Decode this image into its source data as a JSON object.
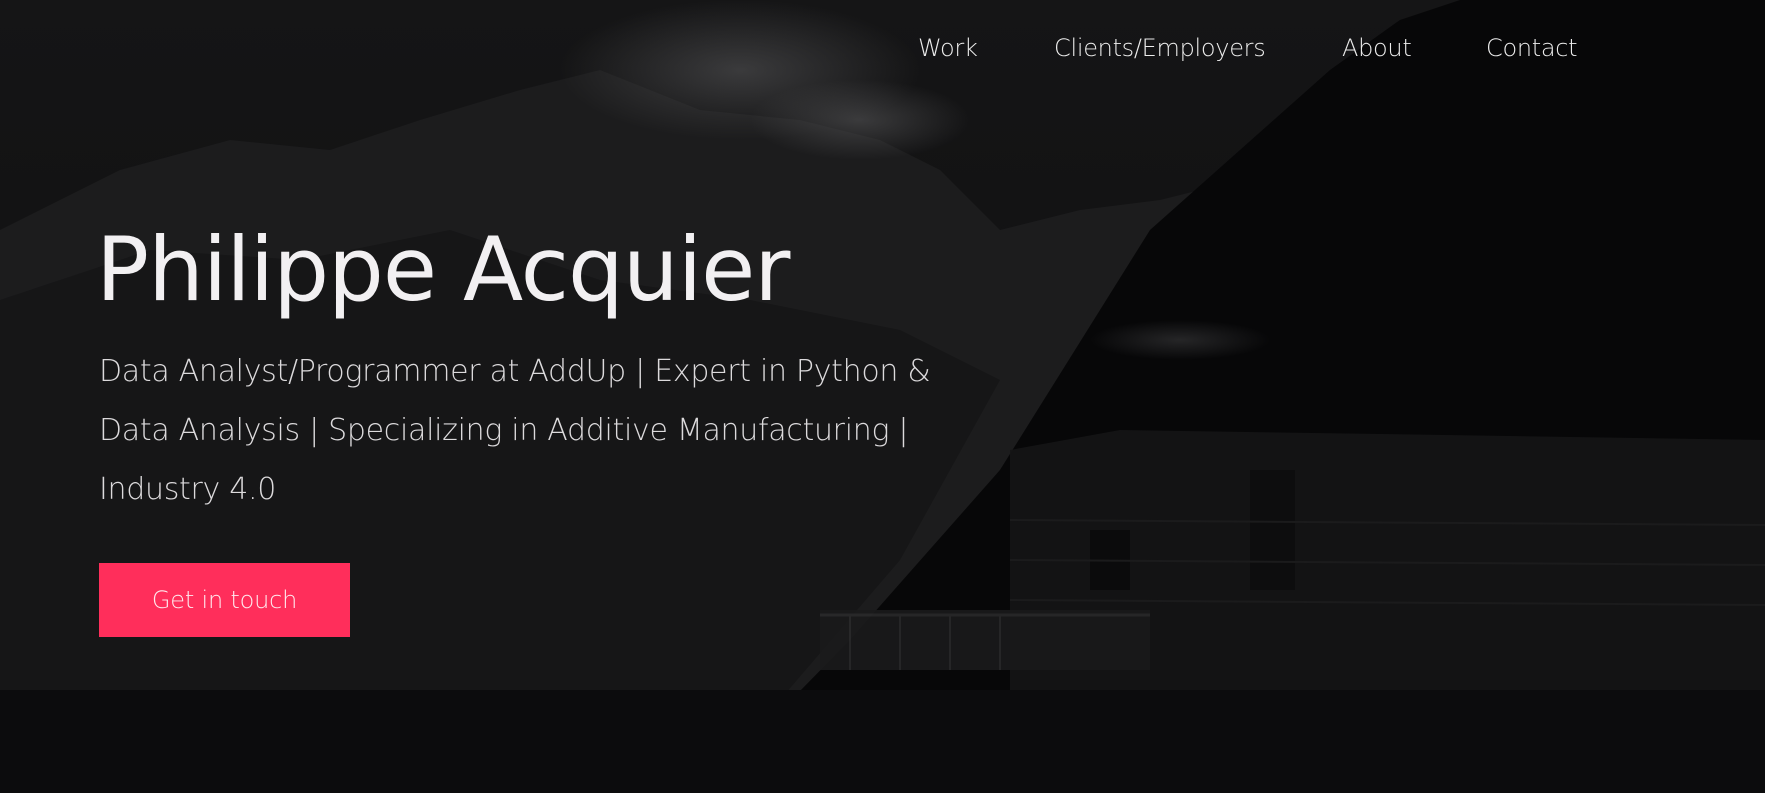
{
  "nav": {
    "items": [
      {
        "label": "Work"
      },
      {
        "label": "Clients/Employers"
      },
      {
        "label": "About"
      },
      {
        "label": "Contact"
      }
    ]
  },
  "hero": {
    "title": "Philippe Acquier",
    "subtitle": "Data Analyst/Programmer at AddUp | Expert in Python & Data Analysis | Specializing in Additive Manufacturing | Industry 4.0",
    "cta_label": "Get in touch"
  },
  "colors": {
    "accent": "#ff2e5b",
    "background": "#0a0a0b",
    "text": "#f2f0f2"
  }
}
